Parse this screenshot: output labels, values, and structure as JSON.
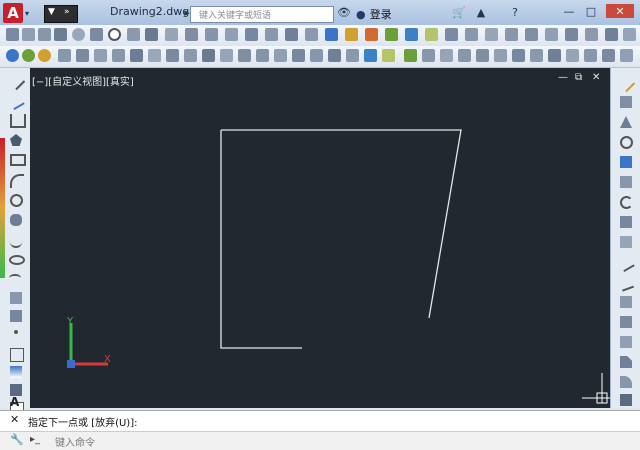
{
  "app": {
    "logo_letter": "A",
    "document_title": "Drawing2.dwg"
  },
  "search": {
    "placeholder": "键入关键字或短语"
  },
  "user": {
    "login_label": "登录"
  },
  "viewport": {
    "label": "[−][自定义视图][真实]"
  },
  "command": {
    "prompt": "指定下一点或 [放弃(U)]:",
    "input_placeholder": "键入命令",
    "prompt_symbol": "▸_"
  },
  "colors": {
    "canvas_bg": "#212830",
    "line": "#e6e6e6",
    "ucs_x": "#d33b3b",
    "ucs_y": "#3bb84a",
    "ucs_z": "#3a6bd3",
    "brand": "#c8202a"
  },
  "ucs": {
    "x_label": "X",
    "y_label": "Y"
  }
}
